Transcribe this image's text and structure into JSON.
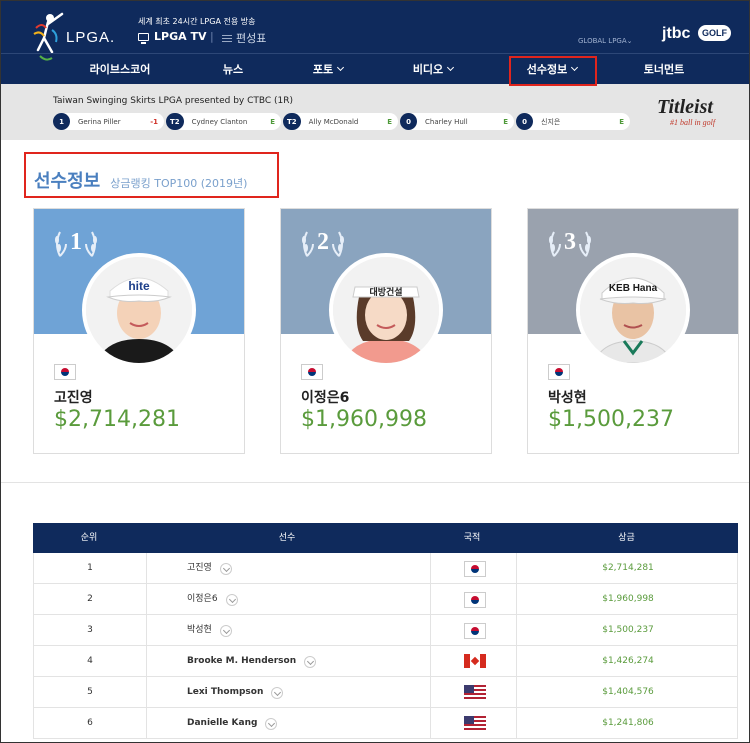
{
  "header": {
    "logo_text": "LPGA.",
    "tagline": "세계 최초 24시간 LPGA 전용 방송",
    "tv_label": "LPGA TV",
    "separator": "|",
    "schedule_label": "편성표",
    "global_label": "GLOBAL LPGA",
    "broadcaster": "jtbc",
    "golf_badge": "GOLF"
  },
  "nav": {
    "items": [
      {
        "label": "라이브스코어",
        "has_dropdown": false
      },
      {
        "label": "뉴스",
        "has_dropdown": false
      },
      {
        "label": "포토",
        "has_dropdown": true
      },
      {
        "label": "비디오",
        "has_dropdown": true
      },
      {
        "label": "선수정보",
        "has_dropdown": true,
        "active": true
      },
      {
        "label": "토너먼트",
        "has_dropdown": false
      }
    ]
  },
  "scoreboard": {
    "event": "Taiwan Swinging Skirts LPGA presented by CTBC (1R)",
    "entries": [
      {
        "pos": "1",
        "name": "Gerina Piller",
        "score": "-1"
      },
      {
        "pos": "T2",
        "name": "Cydney Clanton",
        "score": "E"
      },
      {
        "pos": "T2",
        "name": "Ally McDonald",
        "score": "E"
      },
      {
        "pos": "0",
        "name": "Charley Hull",
        "score": "E"
      },
      {
        "pos": "0",
        "name": "신지은",
        "score": "E"
      }
    ],
    "sponsor": "Titleist",
    "sponsor_tagline": "#1 ball in golf"
  },
  "section": {
    "title": "선수정보",
    "subtitle": "상금랭킹 TOP100 (2019년)"
  },
  "top3": [
    {
      "rank": "1",
      "name": "고진영",
      "money": "$2,714,281",
      "cap_text": "hite",
      "bg": "#6fa3d6"
    },
    {
      "rank": "2",
      "name": "이정은6",
      "money": "$1,960,998",
      "cap_text": "대방건설",
      "bg": "#8aa4bf"
    },
    {
      "rank": "3",
      "name": "박성현",
      "money": "$1,500,237",
      "cap_text": "KEB Hana",
      "bg": "#9aa2ae"
    }
  ],
  "table": {
    "headers": [
      "순위",
      "선수",
      "국적",
      "상금"
    ],
    "rows": [
      {
        "rank": "1",
        "name": "고진영",
        "country": "kr",
        "money": "$2,714,281"
      },
      {
        "rank": "2",
        "name": "이정은6",
        "country": "kr",
        "money": "$1,960,998"
      },
      {
        "rank": "3",
        "name": "박성현",
        "country": "kr",
        "money": "$1,500,237"
      },
      {
        "rank": "4",
        "name": "Brooke M. Henderson",
        "country": "ca",
        "money": "$1,426,274"
      },
      {
        "rank": "5",
        "name": "Lexi Thompson",
        "country": "us",
        "money": "$1,404,576"
      },
      {
        "rank": "6",
        "name": "Danielle Kang",
        "country": "us",
        "money": "$1,241,806"
      }
    ]
  },
  "colors": {
    "brand_navy": "#0f2a5c",
    "money_green": "#5a9b3c",
    "highlight_red": "#e0251d",
    "title_blue": "#4a7fbf"
  }
}
